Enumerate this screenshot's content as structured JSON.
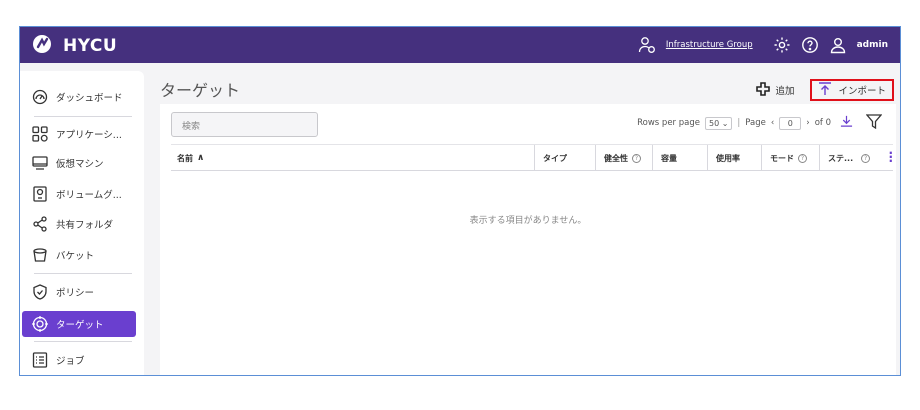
{
  "brand": {
    "name": "HYCU"
  },
  "header": {
    "group_link": "Infrastructure Group",
    "user": "admin",
    "icons": [
      "group-user-icon",
      "gear-icon",
      "help-icon",
      "user-icon"
    ]
  },
  "sidebar": {
    "items": [
      {
        "label": "ダッシュボード",
        "icon": "dashboard-gauge-icon"
      },
      {
        "label": "アプリケーシ...",
        "icon": "applications-grid-icon"
      },
      {
        "label": "仮想マシン",
        "icon": "monitor-icon"
      },
      {
        "label": "ボリュームグ...",
        "icon": "volume-group-icon"
      },
      {
        "label": "共有フォルダ",
        "icon": "share-icon"
      },
      {
        "label": "バケット",
        "icon": "bucket-icon"
      },
      {
        "label": "ポリシー",
        "icon": "shield-icon"
      },
      {
        "label": "ターゲット",
        "icon": "target-icon"
      },
      {
        "label": "ジョブ",
        "icon": "jobs-list-icon"
      }
    ],
    "active_index": 7,
    "accent": "#6a3fcf"
  },
  "main": {
    "title": "ターゲット",
    "add_label": "追加",
    "import_label": "インポート",
    "search_placeholder": "検索",
    "pager": {
      "rows_label": "Rows per page",
      "rows_value": "50",
      "page_label": "Page",
      "page_value": "0",
      "of_label": "of 0"
    },
    "columns": [
      "名前",
      "タイプ",
      "健全性",
      "容量",
      "使用率",
      "モード",
      "ステ..."
    ],
    "empty_message": "表示する項目がありません。"
  },
  "colors": {
    "header_bg": "#45307e",
    "highlight_border": "#e0101a"
  }
}
